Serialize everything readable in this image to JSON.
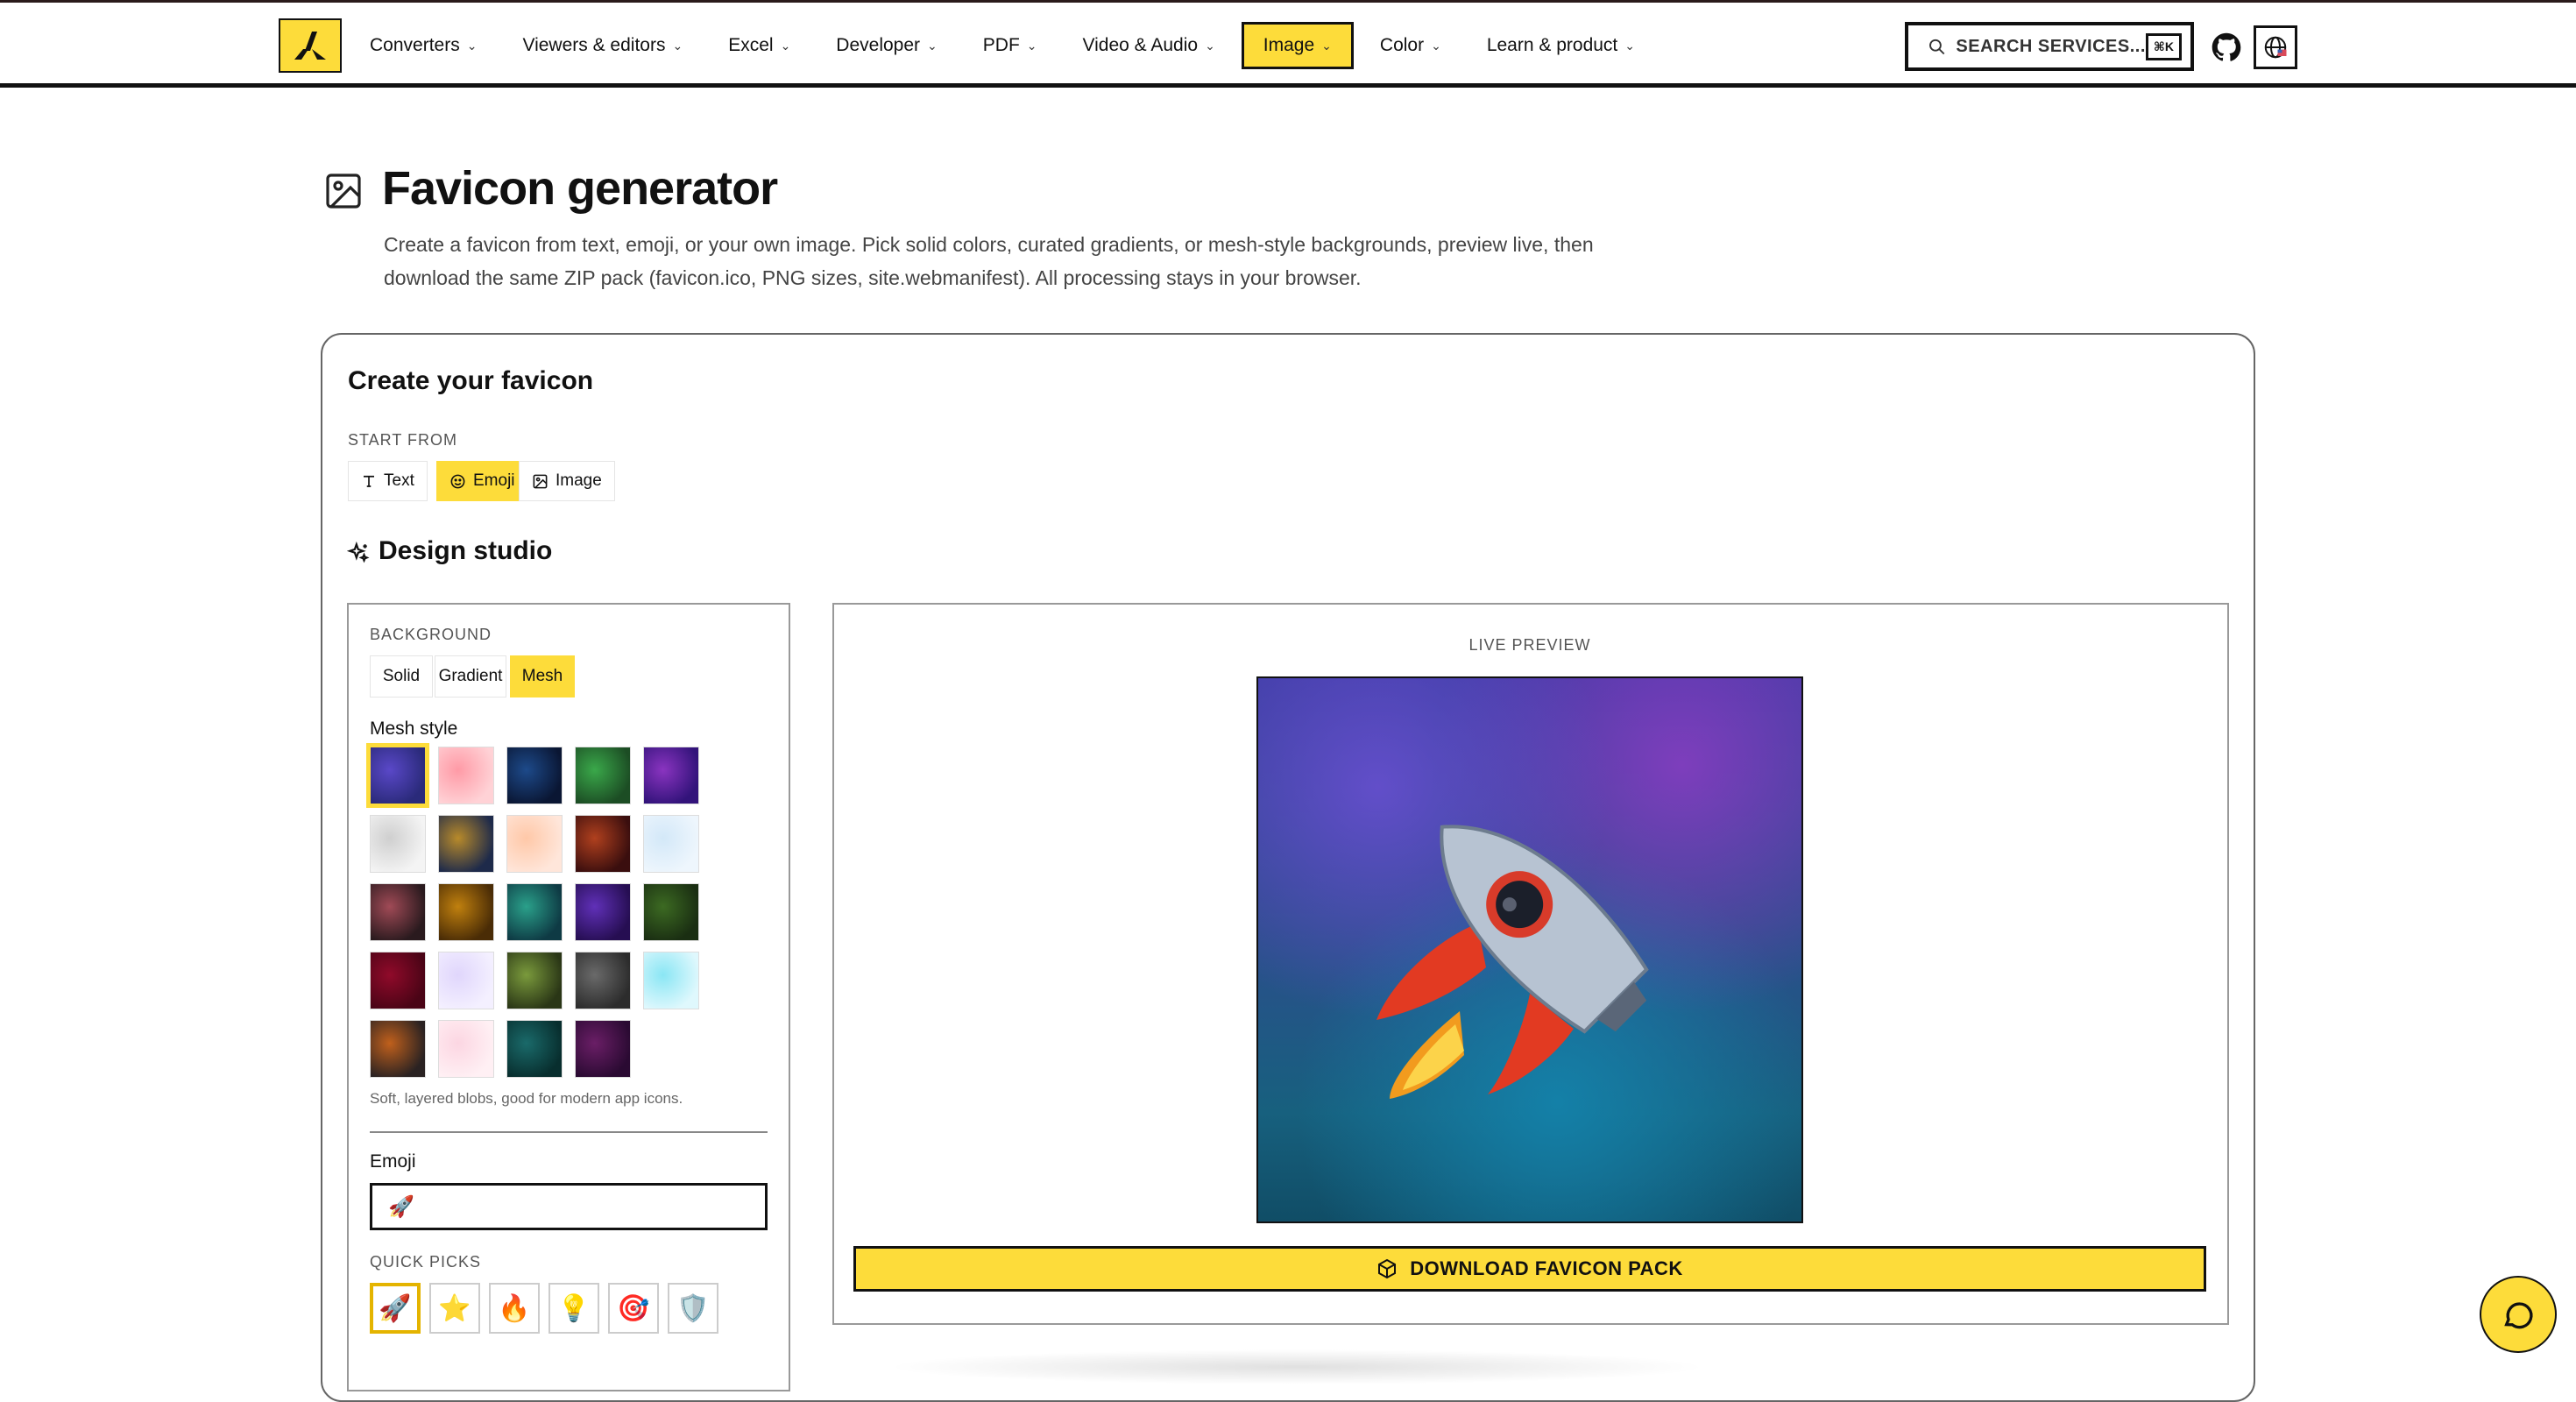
{
  "nav": {
    "items": [
      {
        "label": "Converters"
      },
      {
        "label": "Viewers & editors"
      },
      {
        "label": "Excel"
      },
      {
        "label": "Developer"
      },
      {
        "label": "PDF"
      },
      {
        "label": "Video & Audio"
      },
      {
        "label": "Image",
        "active": true
      },
      {
        "label": "Color"
      },
      {
        "label": "Learn & product"
      }
    ],
    "chevron": "⌄",
    "search_label": "SEARCH SERVICES...",
    "search_shortcut": "⌘K"
  },
  "header": {
    "title": "Favicon generator",
    "description": "Create a favicon from text, emoji, or your own image. Pick solid colors, curated gradients, or mesh-style backgrounds, preview live, then download the same ZIP pack (favicon.ico, PNG sizes, site.webmanifest). All processing stays in your browser."
  },
  "card": {
    "title": "Create your favicon",
    "start_from_label": "START FROM",
    "start_options": [
      {
        "label": "Text",
        "icon": "type-icon"
      },
      {
        "label": "Emoji",
        "icon": "smile-icon",
        "selected": true
      },
      {
        "label": "Image",
        "icon": "image-icon"
      }
    ],
    "studio_title": "Design studio"
  },
  "design": {
    "background_label": "BACKGROUND",
    "background_options": [
      {
        "label": "Solid"
      },
      {
        "label": "Gradient"
      },
      {
        "label": "Mesh",
        "selected": true
      }
    ],
    "mesh_label": "Mesh style",
    "mesh_swatches": [
      {
        "base": "#2a2a7a",
        "blob": "#5a48c8"
      },
      {
        "base": "#ffd2d6",
        "blob": "#ff9aa6"
      },
      {
        "base": "#0a1633",
        "blob": "#1d4a8a"
      },
      {
        "base": "#1c4d24",
        "blob": "#3aa84a"
      },
      {
        "base": "#32137a",
        "blob": "#8a34c0"
      },
      {
        "base": "#f4f4f4",
        "blob": "#cfcfcf"
      },
      {
        "base": "#1e2a4a",
        "blob": "#b88a2a"
      },
      {
        "base": "#ffe6da",
        "blob": "#ffc8a8"
      },
      {
        "base": "#3a0e0e",
        "blob": "#b0401e"
      },
      {
        "base": "#eef6fd",
        "blob": "#d3e8f8"
      },
      {
        "base": "#2a1a1e",
        "blob": "#a04a56"
      },
      {
        "base": "#4a2c06",
        "blob": "#c0800e"
      },
      {
        "base": "#0e3a44",
        "blob": "#2aa08a"
      },
      {
        "base": "#260e52",
        "blob": "#6030b8"
      },
      {
        "base": "#1a2e12",
        "blob": "#3c6a22"
      },
      {
        "base": "#4a0416",
        "blob": "#900a2a"
      },
      {
        "base": "#f4f0ff",
        "blob": "#e0d6fc"
      },
      {
        "base": "#2a3616",
        "blob": "#7a9a3c"
      },
      {
        "base": "#2c2c2c",
        "blob": "#6a6a6a"
      },
      {
        "base": "#dff8fd",
        "blob": "#8ae6f4"
      },
      {
        "base": "#2a2222",
        "blob": "#c0601c"
      },
      {
        "base": "#fff0f4",
        "blob": "#fcd6e2"
      },
      {
        "base": "#082e2e",
        "blob": "#1a6a6a"
      },
      {
        "base": "#2a0a32",
        "blob": "#6a1e66"
      }
    ],
    "mesh_note": "Soft, layered blobs, good for modern app icons.",
    "emoji_label": "Emoji",
    "emoji_value": "🚀",
    "quick_picks_label": "QUICK PICKS",
    "quick_picks": [
      "🚀",
      "⭐",
      "🔥",
      "💡",
      "🎯",
      "🛡️"
    ]
  },
  "preview": {
    "label": "LIVE PREVIEW",
    "download_label": "DOWNLOAD FAVICON PACK"
  },
  "colors": {
    "accent": "#fddc3a",
    "ink": "#111111"
  }
}
